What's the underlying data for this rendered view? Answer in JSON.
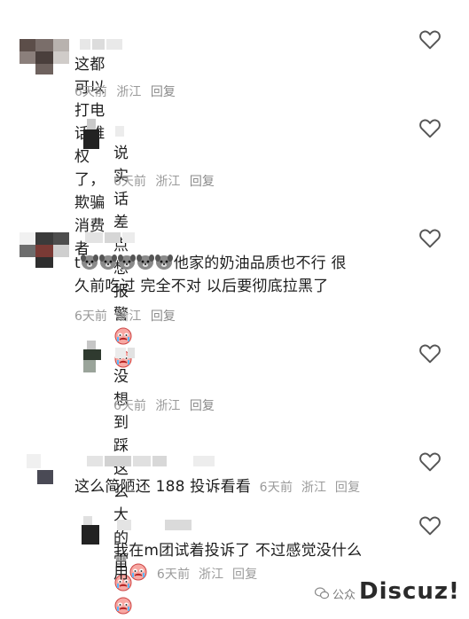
{
  "comments": [
    {
      "text": "这都可以打电话维权了，欺骗消费者",
      "time": "6天前",
      "location": "浙江",
      "reply": "回复",
      "replies": [
        {
          "text": "说实话差点想报警",
          "time": "6天前",
          "location": "浙江",
          "reply": "回复"
        }
      ]
    },
    {
      "text_prefix": "t",
      "text_line1": "他家的奶油品质也不行  很",
      "text_line2": "久前吃过 完全不对  以后要彻底拉黑了",
      "time": "6天前",
      "location": "浙江",
      "reply": "回复",
      "replies": [
        {
          "text": "没想到踩这么大的雷",
          "time": "6天前",
          "location": "浙江",
          "reply": "回复"
        }
      ]
    },
    {
      "text": "这么简陋还 188  投诉看看",
      "time": "6天前",
      "location": "浙江",
      "reply": "回复",
      "replies": [
        {
          "text_line1": "我在m团试着投诉了 不过感觉没什么",
          "text_line2": "用",
          "time": "6天前",
          "location": "浙江",
          "reply": "回复"
        }
      ]
    }
  ],
  "icons": {
    "like": "heart-outline-icon",
    "emoji_cry": "crying-face-icon",
    "emoji_dog": "dog-head-icon",
    "wechat": "wechat-icon"
  },
  "colors": {
    "meta": "#9a9a9a",
    "text": "#1e1e1e",
    "heart": "#555555"
  },
  "watermark": {
    "prefix": "公众",
    "brand": "Discuz!"
  }
}
